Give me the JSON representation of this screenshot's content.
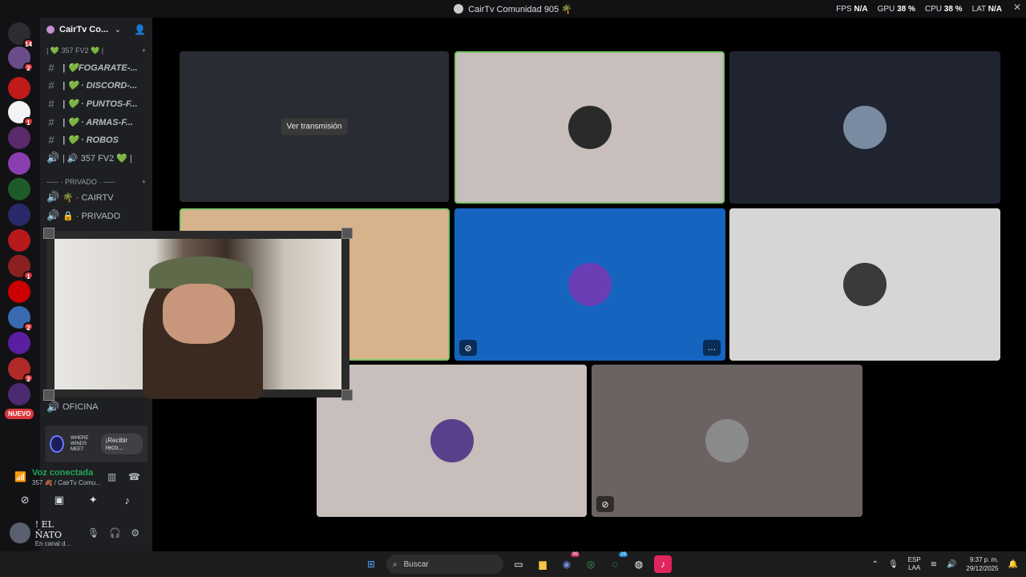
{
  "window": {
    "title": "CairTv Comunidad 905 🌴"
  },
  "stats": [
    {
      "label": "FPS",
      "value": "N/A"
    },
    {
      "label": "GPU",
      "value": "38 %"
    },
    {
      "label": "CPU",
      "value": "38 %"
    },
    {
      "label": "LAT",
      "value": "N/A"
    }
  ],
  "server_badges": {
    "home": "14",
    "s1": "2",
    "s2": "1",
    "s3": "1",
    "s4": "2",
    "s5": "2"
  },
  "nuevo_label": "NUEVO",
  "server": {
    "name": "CairTv Co..."
  },
  "channels": [
    {
      "icon": "",
      "name": "| 💚 357 FV2 💚 |"
    },
    {
      "icon": "#",
      "name": "| 💚FOGARATE-..."
    },
    {
      "icon": "#",
      "name": "| 💚 · DISCORD-..."
    },
    {
      "icon": "#",
      "name": "| 💚 · PUNTOS-F..."
    },
    {
      "icon": "#",
      "name": "| 💚 · ARMAS-F..."
    },
    {
      "icon": "#",
      "name": "| 💚 · ROBOS"
    },
    {
      "icon": "🔊",
      "name": "| 🔊 357 FV2 💚 |"
    }
  ],
  "category_private": "----- · PRIVADO · -----",
  "private_channels": [
    {
      "icon": "🔊",
      "name": "🌴 · CAIRTV"
    },
    {
      "icon": "🔊",
      "name": "🔒 · PRIVADO"
    }
  ],
  "oficina": "OFICINA",
  "activity": {
    "game": "WHERE WINDS MEET",
    "button": "¡Recibir reco..."
  },
  "voice": {
    "status": "Voz conectada",
    "sub": "357 🍂 / CairTv Comu..."
  },
  "user": {
    "name": "! EL ÑATO",
    "status": "En canal d..."
  },
  "stream_button": "Ver transmisión",
  "taskbar": {
    "search": "Buscar",
    "lang": "ESP",
    "lang2": "LAA",
    "time": "9:37 p. m.",
    "date": "29/12/2025",
    "discord_badge": "99",
    "wa_badge": "29"
  }
}
